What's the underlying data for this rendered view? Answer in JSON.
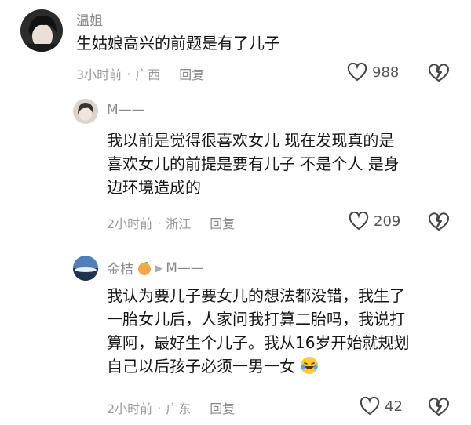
{
  "comments": [
    {
      "name": "温姐",
      "text": "生姑娘高兴的前题是有了儿子",
      "time": "3小时前",
      "sep": "·",
      "location": "广西",
      "reply": "回复",
      "likes": "988"
    },
    {
      "name": "M——",
      "text_lines": [
        "我以前是觉得很喜欢女儿 现在发现真的是",
        "喜欢女儿的前提是要有儿子 不是个人 是身",
        "边环境造成的"
      ],
      "time": "2小时前",
      "sep": "·",
      "location": "浙江",
      "reply": "回复",
      "likes": "209"
    },
    {
      "name": "金桔",
      "reply_to": "M——",
      "text_lines": [
        "我认为要儿子要女儿的想法都没错，我生了",
        "一胎女儿后，人家问我打算二胎吗，我说打",
        "算阿，最好生个儿子。我从16岁开始就规划",
        "自己以后孩子必须一男一女"
      ],
      "time": "2小时前",
      "sep": "·",
      "location": "广东",
      "reply": "回复",
      "likes": "42"
    }
  ],
  "icons": {
    "like": "heart-outline-icon",
    "dislike": "broken-heart-icon",
    "name_badge": "orange-emoji",
    "text_emoji": "laughing-crying-emoji",
    "reply_arrow": "play-triangle-icon"
  },
  "colors": {
    "name": "#8a8a8a",
    "text": "#161616",
    "meta": "#9a9a9a"
  }
}
